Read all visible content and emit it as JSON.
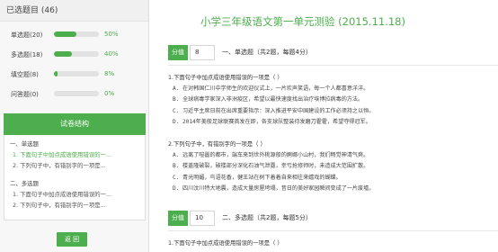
{
  "sidebar": {
    "header": "已选题目 (46)",
    "stats": [
      {
        "label": "单选题(20)",
        "percent": "50%",
        "fraction": 0.5
      },
      {
        "label": "多选题(18)",
        "percent": "40%",
        "fraction": 0.4
      },
      {
        "label": "填空题(8)",
        "percent": "8%",
        "fraction": 0.08
      },
      {
        "label": "问答题(0)",
        "percent": "0%",
        "fraction": 0
      }
    ],
    "structure_title": "试卷结构",
    "structure": {
      "sec1": "一、单选题",
      "sec1_q1": "1. 下面句子中加点成语使用错误的一...",
      "sec1_q2": "2. 下列句子中，有错别字的一项是...",
      "sec2": "二、多选题",
      "sec2_q1": "1. 下面句子中加点成语使用错误的一...",
      "sec2_q2": "2. 下列句子中，有错别字的一项是..."
    },
    "back_label": "返 回"
  },
  "main": {
    "title": "小学三年级语文第一单元测验 (2015.11.18)",
    "sections": [
      {
        "points_label": "分值",
        "points_value": "8",
        "desc": "一、单选题（共2题，每题4分）"
      },
      {
        "points_label": "分值",
        "points_value": "10",
        "desc": "二、多选题（共2题，每题5分）"
      }
    ],
    "q1": {
      "stem": "1.下面句子中加点成语使用错误的一项是（    ）",
      "options": [
        "A. 在对韩国仁川中学师生的欢迎仪式上，一片欢声笑语，每一个人都喜意洋洋。",
        "B. 全球病毒学家深入非洲疫区，希望以最快速度找出治疗埃博拉病毒的方法。",
        "C. 习近平主席日前在出席重要指示：深入推进平安中国建设的工作必须持之以恒。",
        "D. 2014年美般足球联赛首发在即，各支球队整装待发磨刀霍霍，希望夺得冠军。"
      ]
    },
    "q2": {
      "stem": "2.下列句子中，有错别字的一项是（    ）",
      "options": [
        "A. 远离了喧嚣的都市，端车来到世外桃源般的婀娜小山村，我们畅觉神清气爽。",
        "B. 楼盖隆破裂，破楼部分深化石油气泄露，幸亏抢修师时，未造成大范围扩散。",
        "C. 青光明媚，鸟语花香，健王站在树下着着自来相往来嬉戏的蝴蝶。",
        "D. 四川汶川特大地震，造成大量房屋垮塌，昔日的美好家园瞬间变成了一片废墟。"
      ]
    },
    "q3": {
      "stem": "1.下面句子中加点成语使用错误的一项是（    ）"
    }
  },
  "colors": {
    "accent": "#4cae4c",
    "sidebar_bg": "#f7f7f7"
  }
}
